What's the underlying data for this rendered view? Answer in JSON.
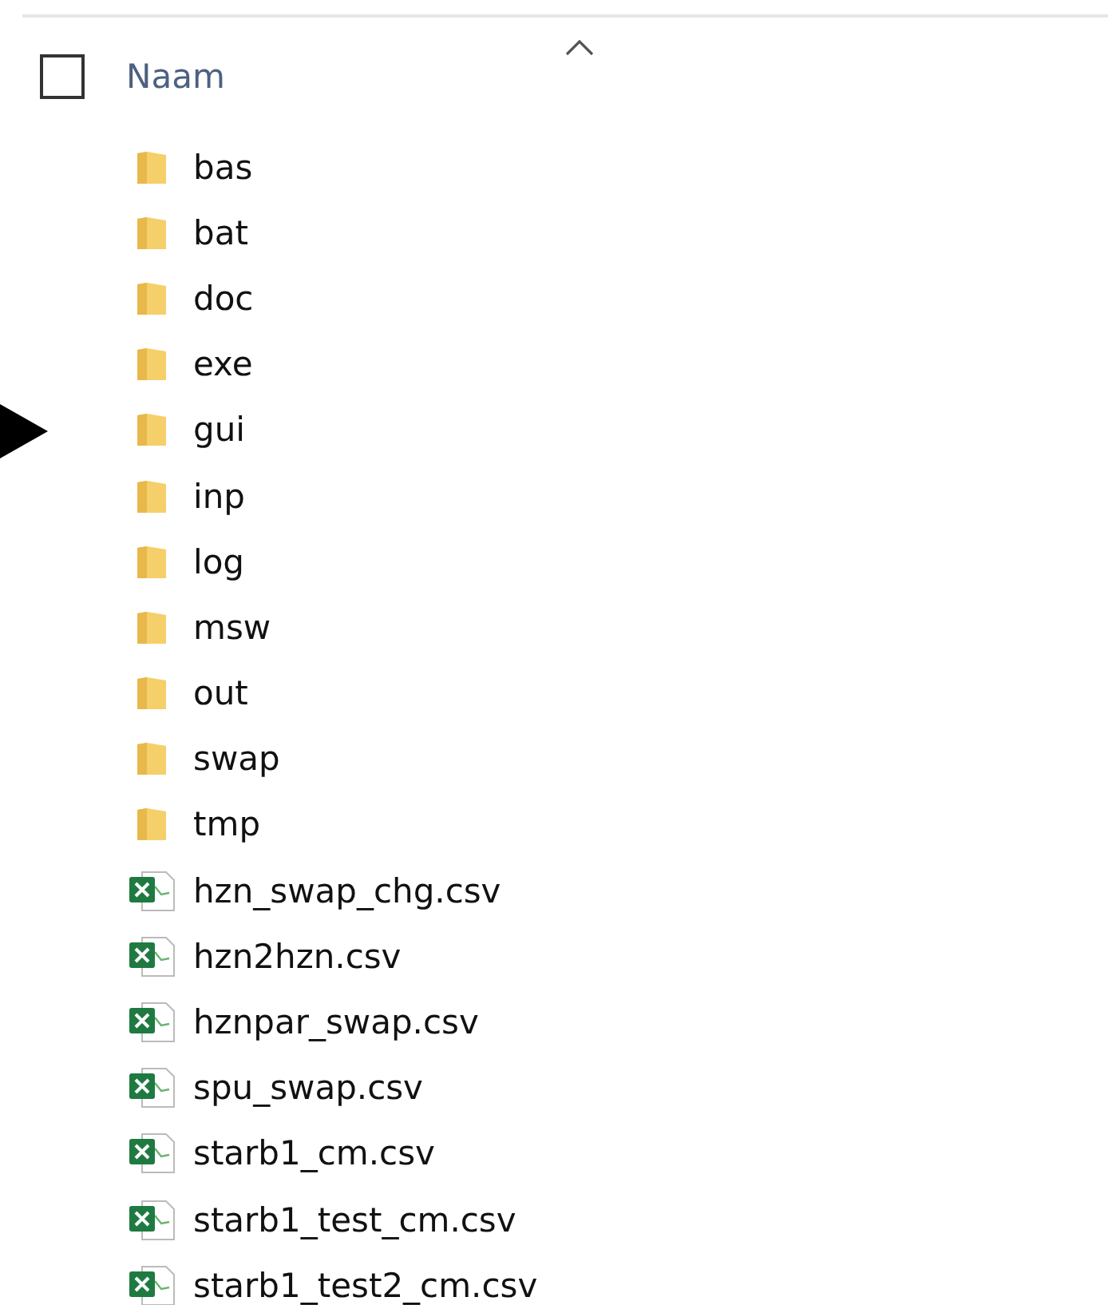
{
  "header": {
    "checked": false,
    "column_label": "Naam",
    "sort_ascending": true
  },
  "items": [
    {
      "kind": "folder",
      "name": "bas",
      "pointed": false
    },
    {
      "kind": "folder",
      "name": "bat",
      "pointed": false
    },
    {
      "kind": "folder",
      "name": "doc",
      "pointed": false
    },
    {
      "kind": "folder",
      "name": "exe",
      "pointed": false
    },
    {
      "kind": "folder",
      "name": "gui",
      "pointed": true
    },
    {
      "kind": "folder",
      "name": "inp",
      "pointed": false
    },
    {
      "kind": "folder",
      "name": "log",
      "pointed": false
    },
    {
      "kind": "folder",
      "name": "msw",
      "pointed": false
    },
    {
      "kind": "folder",
      "name": "out",
      "pointed": false
    },
    {
      "kind": "folder",
      "name": "swap",
      "pointed": false
    },
    {
      "kind": "folder",
      "name": "tmp",
      "pointed": false
    },
    {
      "kind": "csv",
      "name": "hzn_swap_chg.csv",
      "pointed": false
    },
    {
      "kind": "csv",
      "name": "hzn2hzn.csv",
      "pointed": false
    },
    {
      "kind": "csv",
      "name": "hznpar_swap.csv",
      "pointed": false
    },
    {
      "kind": "csv",
      "name": "spu_swap.csv",
      "pointed": false
    },
    {
      "kind": "csv",
      "name": "starb1_cm.csv",
      "pointed": false
    },
    {
      "kind": "csv",
      "name": "starb1_test_cm.csv",
      "pointed": false
    },
    {
      "kind": "csv",
      "name": "starb1_test2_cm.csv",
      "pointed": false
    }
  ]
}
